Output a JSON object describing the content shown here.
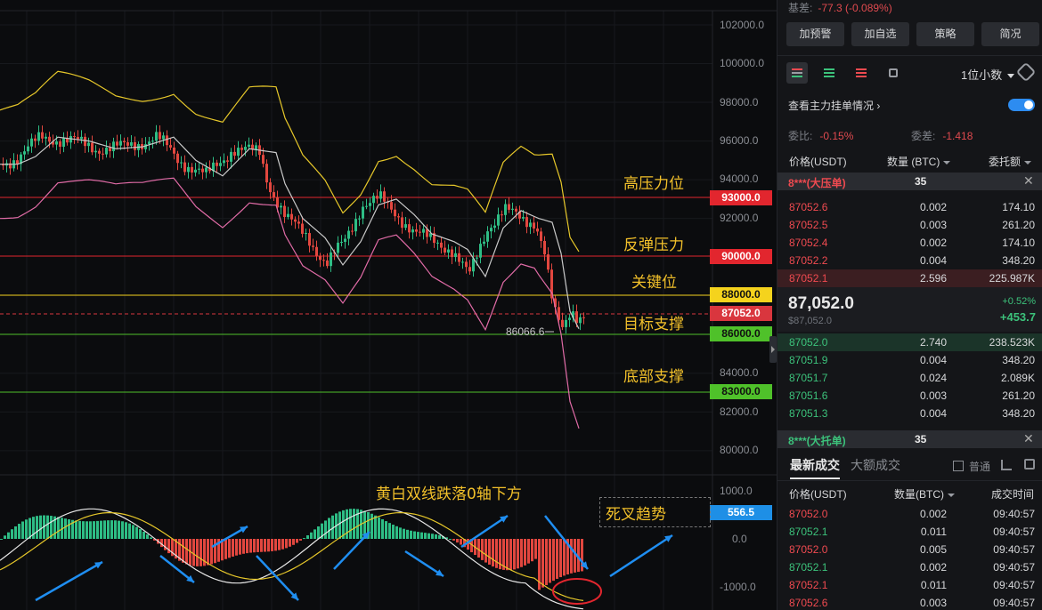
{
  "chart": {
    "price_axis": [
      "102000.0",
      "100000.0",
      "98000.0",
      "96000.0",
      "94000.0",
      "92000.0",
      "90000.0",
      "88000.0",
      "86000.0",
      "84000.0",
      "82000.0",
      "80000.0"
    ],
    "macd_axis": [
      "1000.0",
      "0.0",
      "-1000.0"
    ],
    "tags": {
      "high": "93000.0",
      "rebound": "90000.0",
      "key": "88000.0",
      "current": "87052.0",
      "target": "86000.0",
      "bottom": "83000.0",
      "macd": "556.5"
    },
    "annotations": {
      "high_pressure": "高压力位",
      "rebound_pressure": "反弹压力",
      "key_level": "关键位",
      "target_support": "目标支撑",
      "bottom_support": "底部支撑",
      "macd_note": "黄白双线跌落0轴下方",
      "death_cross": "死叉趋势"
    },
    "low_label": "86066.6",
    "colors": {
      "up": "#2ebd85",
      "down": "#e2473f",
      "bb_upper": "#e6c72a",
      "bb_mid": "#c9c9c9",
      "bb_lower": "#e06ba6",
      "arrow": "#1f8ef1"
    }
  },
  "panel": {
    "basis_label": "基差:",
    "basis_value": "-77.3 (-0.089%)",
    "buttons": [
      "加预警",
      "加自选",
      "策略",
      "简况"
    ],
    "decimals": "1位小数",
    "main_orders": "查看主力挂单情况",
    "ratio_label": "委比:",
    "ratio_value": "-0.15%",
    "diff_label": "委差:",
    "diff_value": "-1.418",
    "headers": {
      "price": "价格(USDT)",
      "qty": "数量 (BTC)",
      "total": "委托额"
    },
    "big_ask": {
      "label": "8***(大压单)",
      "count": "35"
    },
    "asks": [
      {
        "price": "87052.6",
        "qty": "0.002",
        "total": "174.10"
      },
      {
        "price": "87052.5",
        "qty": "0.003",
        "total": "261.20"
      },
      {
        "price": "87052.4",
        "qty": "0.002",
        "total": "174.10"
      },
      {
        "price": "87052.2",
        "qty": "0.004",
        "total": "348.20"
      },
      {
        "price": "87052.1",
        "qty": "2.596",
        "total": "225.987K"
      }
    ],
    "last_price": "87,052.0",
    "last_price_usd": "$87,052.0",
    "change_pct": "+0.52%",
    "change_abs": "+453.7",
    "bids": [
      {
        "price": "87052.0",
        "qty": "2.740",
        "total": "238.523K"
      },
      {
        "price": "87051.9",
        "qty": "0.004",
        "total": "348.20"
      },
      {
        "price": "87051.7",
        "qty": "0.024",
        "total": "2.089K"
      },
      {
        "price": "87051.6",
        "qty": "0.003",
        "total": "261.20"
      },
      {
        "price": "87051.3",
        "qty": "0.004",
        "total": "348.20"
      }
    ],
    "big_bid": {
      "label": "8***(大托单)",
      "count": "35"
    },
    "trade_tabs": {
      "latest": "最新成交",
      "large": "大额成交"
    },
    "normal_label": "普通",
    "trade_headers": {
      "price": "价格(USDT)",
      "qty": "数量(BTC)",
      "time": "成交时间"
    },
    "trades": [
      {
        "price": "87052.0",
        "side": "sell",
        "qty": "0.002",
        "time": "09:40:57"
      },
      {
        "price": "87052.1",
        "side": "buy",
        "qty": "0.011",
        "time": "09:40:57"
      },
      {
        "price": "87052.0",
        "side": "sell",
        "qty": "0.005",
        "time": "09:40:57"
      },
      {
        "price": "87052.1",
        "side": "buy",
        "qty": "0.002",
        "time": "09:40:57"
      },
      {
        "price": "87052.1",
        "side": "sell",
        "qty": "0.011",
        "time": "09:40:57"
      },
      {
        "price": "87052.6",
        "side": "sell",
        "qty": "0.003",
        "time": "09:40:57"
      }
    ]
  }
}
